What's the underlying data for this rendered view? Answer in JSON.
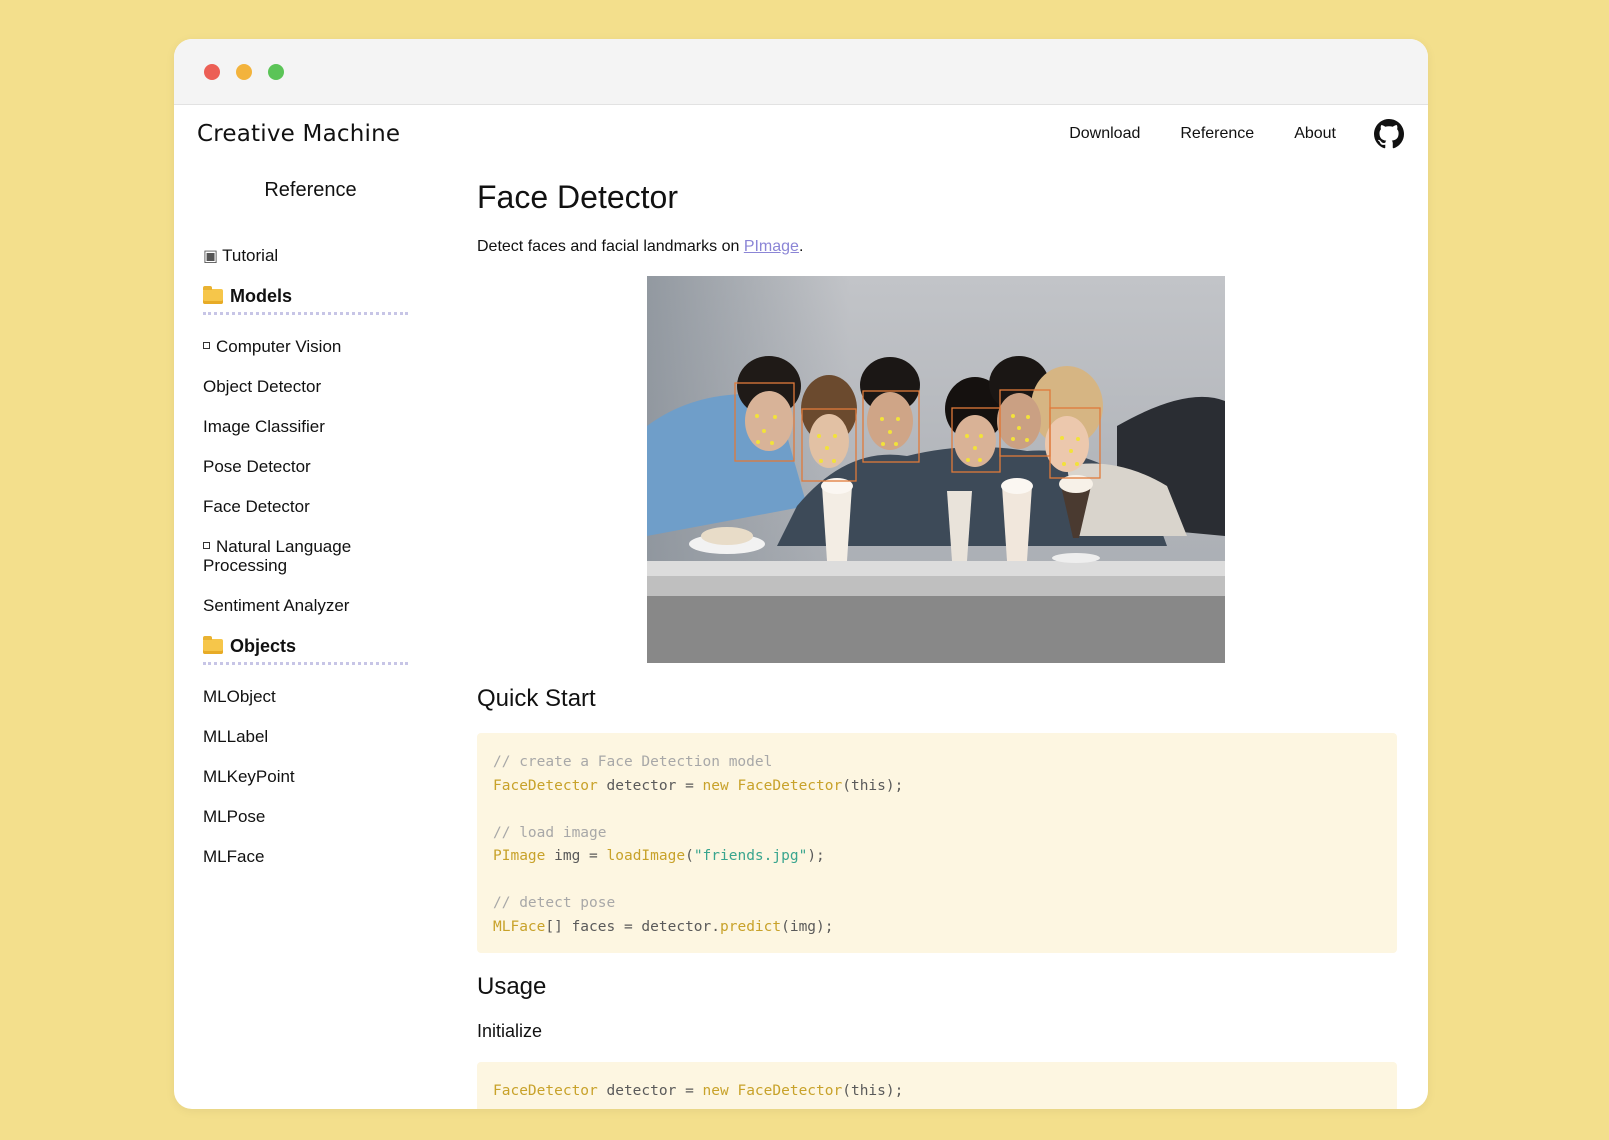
{
  "brand": "Creative Machine",
  "nav": {
    "download": "Download",
    "reference": "Reference",
    "about": "About",
    "github_icon": "github-icon"
  },
  "sidebar": {
    "title": "Reference",
    "tutorial": "Tutorial",
    "models_group": "Models",
    "items_models": [
      "Computer Vision",
      "Object Detector",
      "Image Classifier",
      "Pose Detector",
      "Face Detector",
      "Natural Language Processing",
      "Sentiment Analyzer"
    ],
    "objects_group": "Objects",
    "items_objects": [
      "MLObject",
      "MLLabel",
      "MLKeyPoint",
      "MLPose",
      "MLFace"
    ]
  },
  "main": {
    "title": "Face Detector",
    "desc_prefix": "Detect faces and facial landmarks on ",
    "desc_link": "PImage",
    "desc_suffix": ".",
    "quick_start": "Quick Start",
    "code1": {
      "c1": "// create a Face Detection model",
      "l1_type": "FaceDetector",
      "l1_mid": " detector = ",
      "l1_new": "new",
      "l1_sp": " ",
      "l1_ctor": "FaceDetector",
      "l1_end": "(this);",
      "c2": "// load image",
      "l2_type": "PImage",
      "l2_mid": " img = ",
      "l2_fn": "loadImage",
      "l2_open": "(",
      "l2_str": "\"friends.jpg\"",
      "l2_end": ");",
      "c3": "// detect pose",
      "l3_type": "MLFace",
      "l3_mid": "[] faces = detector.",
      "l3_fn": "predict",
      "l3_end": "(img);"
    },
    "usage": "Usage",
    "initialize": "Initialize",
    "code2": {
      "l1_type": "FaceDetector",
      "l1_mid": " detector = ",
      "l1_new": "new",
      "l1_sp": " ",
      "l1_ctor": "FaceDetector",
      "l1_end": "(this);"
    }
  },
  "colors": {
    "page_bg": "#f3df8c",
    "link": "#8b85d6",
    "code_bg": "#fdf6e1",
    "code_type": "#c8a22a",
    "code_string": "#39a58e",
    "code_comment": "#a8a8a8",
    "face_box": "#e07a3a",
    "landmark": "#f2e23a"
  }
}
